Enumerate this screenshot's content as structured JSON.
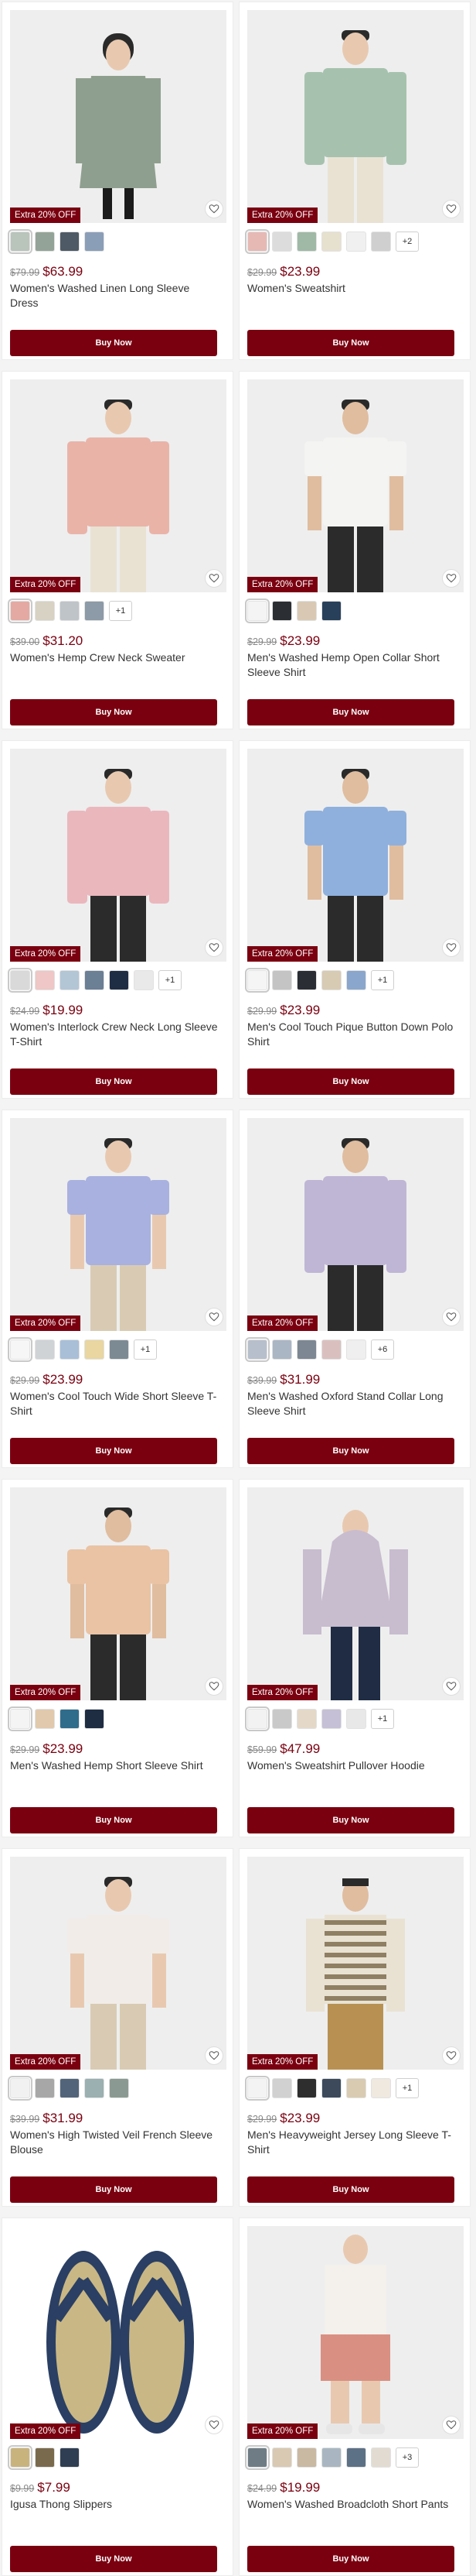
{
  "colors": {
    "accent": "#7a0010",
    "badge_bg": "#7a0010",
    "sale_price": "#7a0010"
  },
  "badge_text": "Extra 20% OFF",
  "buy_label": "Buy Now",
  "products": [
    {
      "name": "Women's Washed Linen Long Sleeve Dress",
      "original_price": "$79.99",
      "sale_price": "$63.99",
      "swatches": [
        "#b9c4bb",
        "#94a397",
        "#4e5a66",
        "#8b9eb8"
      ],
      "more": "",
      "image": {
        "bg": "#eeeeee",
        "garment": "#8f9f8f",
        "skin": "#e8c9b0",
        "type": "dress"
      }
    },
    {
      "name": "Women's Sweatshirt",
      "original_price": "$29.99",
      "sale_price": "$23.99",
      "swatches": [
        "#e6b9b5",
        "#dcdcdc",
        "#9fb9a6",
        "#e6e0cf",
        "#f0f0f0",
        "#cfcfcf"
      ],
      "more": "+2",
      "image": {
        "bg": "#eeeeee",
        "garment": "#a6c2ae",
        "skin": "#e8c9b0",
        "type": "sweater"
      }
    },
    {
      "name": "Women's Hemp Crew Neck Sweater",
      "original_price": "$39.00",
      "sale_price": "$31.20",
      "swatches": [
        "#e4a9a2",
        "#d8d2c4",
        "#bfc4c9",
        "#8d9aa7"
      ],
      "more": "+1",
      "image": {
        "bg": "#eeeeee",
        "garment": "#eab3a8",
        "skin": "#e8c9b0",
        "type": "sweater"
      }
    },
    {
      "name": "Men's Washed Hemp Open Collar Short Sleeve Shirt",
      "original_price": "$29.99",
      "sale_price": "$23.99",
      "swatches": [
        "#f4f4f4",
        "#2b2f33",
        "#d9c9b4",
        "#28405a"
      ],
      "more": "",
      "image": {
        "bg": "#eeeeee",
        "garment": "#f4f4f2",
        "skin": "#e0bd9f",
        "type": "shirt"
      }
    },
    {
      "name": "Women's Interlock Crew Neck Long Sleeve T-Shirt",
      "original_price": "$24.99",
      "sale_price": "$19.99",
      "swatches": [
        "#d9d9d9",
        "#eec7c6",
        "#b3c6d6",
        "#6b7f95",
        "#1f2d44",
        "#e9e9e9"
      ],
      "more": "+1",
      "image": {
        "bg": "#eeeeee",
        "garment": "#eab7bd",
        "skin": "#e8c9b0",
        "type": "longsleeve"
      }
    },
    {
      "name": "Men's Cool Touch Pique Button Down Polo Shirt",
      "original_price": "$29.99",
      "sale_price": "$23.99",
      "swatches": [
        "#f5f5f5",
        "#c4c4c4",
        "#2a2d33",
        "#d8cbb3",
        "#8aa6cc"
      ],
      "more": "+1",
      "image": {
        "bg": "#eeeeee",
        "garment": "#8fb0dd",
        "skin": "#e0bd9f",
        "type": "shirt"
      }
    },
    {
      "name": "Women's Cool Touch Wide Short Sleeve T-Shirt",
      "original_price": "$29.99",
      "sale_price": "$23.99",
      "swatches": [
        "#f6f6f6",
        "#cfd3d6",
        "#a9bfd8",
        "#e9d6a0",
        "#7c8a93"
      ],
      "more": "+1",
      "image": {
        "bg": "#eeeeee",
        "garment": "#a9b1e0",
        "skin": "#e8c9b0",
        "type": "tee"
      }
    },
    {
      "name": "Men's Washed Oxford Stand Collar Long Sleeve Shirt",
      "original_price": "$39.99",
      "sale_price": "$31.99",
      "swatches": [
        "#b8bfcc",
        "#aab6c4",
        "#7d8793",
        "#d9c0bf",
        "#efefef"
      ],
      "more": "+6",
      "image": {
        "bg": "#eeeeee",
        "garment": "#bfb6d6",
        "skin": "#e0bd9f",
        "type": "longsleeve"
      }
    },
    {
      "name": "Men's Washed Hemp Short Sleeve Shirt",
      "original_price": "$29.99",
      "sale_price": "$23.99",
      "swatches": [
        "#f4f4f4",
        "#e1c9ae",
        "#2f6c8c",
        "#1e2d42"
      ],
      "more": "",
      "image": {
        "bg": "#eeeeee",
        "garment": "#e9c3a4",
        "skin": "#e0bd9f",
        "type": "shirt"
      }
    },
    {
      "name": "Women's Sweatshirt Pullover Hoodie",
      "original_price": "$59.99",
      "sale_price": "$47.99",
      "swatches": [
        "#f2f2f2",
        "#c9c9c9",
        "#e4d9c8",
        "#c6c0d6",
        "#e8e8e8"
      ],
      "more": "+1",
      "image": {
        "bg": "#eeeeee",
        "garment": "#c8bccf",
        "skin": "#e8c9b0",
        "type": "hoodie"
      }
    },
    {
      "name": "Women's High Twisted Veil French Sleeve Blouse",
      "original_price": "$39.99",
      "sale_price": "$31.99",
      "swatches": [
        "#f1f1f1",
        "#a7a7a7",
        "#52647a",
        "#9bb0b0",
        "#8a9a92"
      ],
      "more": "",
      "image": {
        "bg": "#eeeeee",
        "garment": "#f1ece7",
        "skin": "#e8c9b0",
        "type": "tee"
      }
    },
    {
      "name": "Men's Heavyweight Jersey Long Sleeve T-Shirt",
      "original_price": "$29.99",
      "sale_price": "$23.99",
      "swatches": [
        "#f3f3f3",
        "#d1d1d1",
        "#2e2e2e",
        "#3c4a5c",
        "#d9cbb1",
        "#efe9df"
      ],
      "more": "+1",
      "image": {
        "bg": "#eeeeee",
        "garment": "#e9e2d3",
        "skin": "#e0bd9f",
        "type": "stripes"
      }
    },
    {
      "name": "Igusa Thong Slippers",
      "original_price": "$9.99",
      "sale_price": "$7.99",
      "swatches": [
        "#c9b37d",
        "#7a6a4d",
        "#2f3e52"
      ],
      "more": "",
      "image": {
        "bg": "#ffffff",
        "garment": "#2a3f63",
        "skin": "#c9b785",
        "type": "slippers"
      }
    },
    {
      "name": "Women's Washed Broadcloth Short Pants",
      "original_price": "$24.99",
      "sale_price": "$19.99",
      "swatches": [
        "#6f7c85",
        "#d9c9b2",
        "#c9b8a2",
        "#a9b6c2",
        "#5c7185",
        "#e1dbd2"
      ],
      "more": "+3",
      "image": {
        "bg": "#eeeeee",
        "garment": "#d98f82",
        "skin": "#e8c9b0",
        "type": "shorts"
      }
    }
  ]
}
